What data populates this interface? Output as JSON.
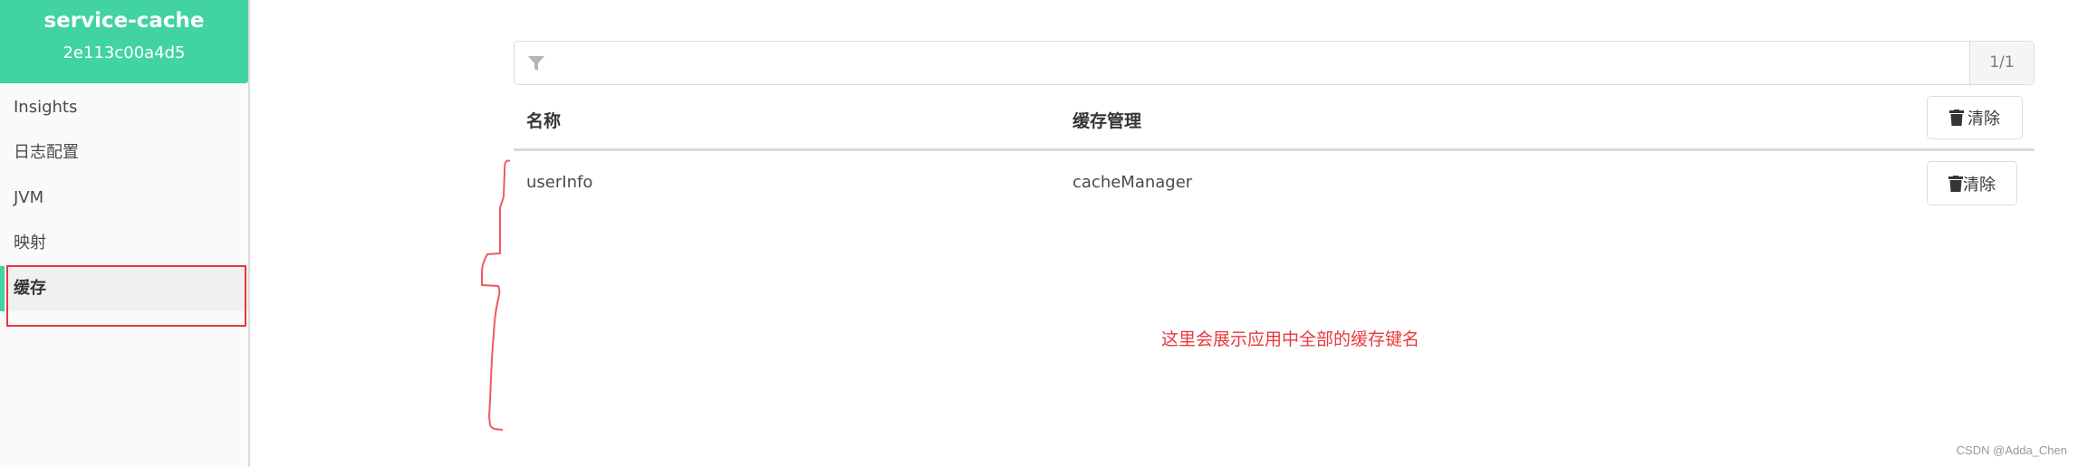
{
  "app": {
    "name": "service-cache",
    "instance_id": "2e113c00a4d5",
    "accent_color": "#42d3a5"
  },
  "sidebar": {
    "items": [
      {
        "label": "Insights",
        "active": false
      },
      {
        "label": "日志配置",
        "active": false
      },
      {
        "label": "JVM",
        "active": false
      },
      {
        "label": "映射",
        "active": false
      },
      {
        "label": "缓存",
        "active": true
      }
    ]
  },
  "filter": {
    "icon": "filter-icon",
    "value": "",
    "placeholder": "",
    "page_indicator": "1/1"
  },
  "table": {
    "columns": [
      "名称",
      "缓存管理"
    ],
    "header_action": {
      "icon": "trash-icon",
      "label": "清除"
    },
    "rows": [
      {
        "name": "userInfo",
        "cache_manager": "cacheManager",
        "action": {
          "icon": "trash-icon",
          "label": "清除"
        }
      }
    ]
  },
  "annotations": {
    "note": "这里会展示应用中全部的缓存键名",
    "annotation_color": "#e8383d"
  },
  "watermark": "CSDN @Adda_Chen"
}
